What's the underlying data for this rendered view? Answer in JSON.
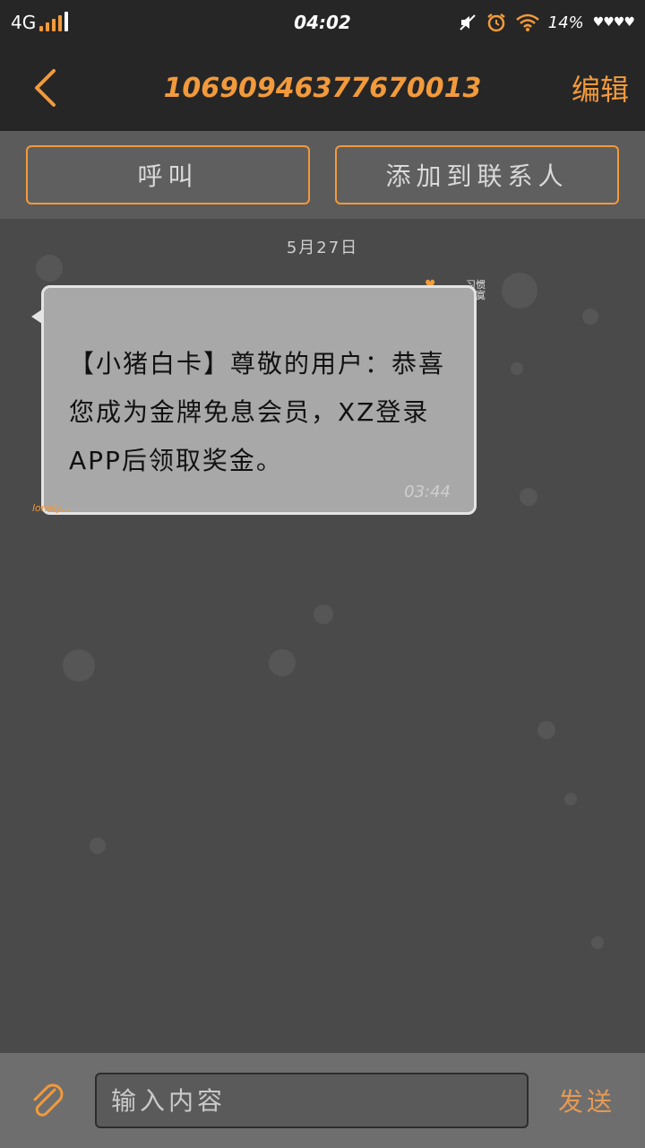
{
  "status_bar": {
    "network": "4G",
    "time": "04:02",
    "battery": "14%",
    "signal_level": 4
  },
  "header": {
    "title": "10690946377670013",
    "edit_label": "编辑",
    "back_icon": "chevron-left-icon"
  },
  "actions": {
    "call_label": "呼叫",
    "add_contact_label": "添加到联系人"
  },
  "conversation": {
    "date": "5月27日",
    "messages": [
      {
        "text": "【小猪白卡】尊敬的用户：恭喜您成为金牌免息会员，XZ登录APP后领取奖金。",
        "time": "03:44"
      }
    ],
    "decoration_text": "习惯寂寞",
    "decoration_tag": "lonely..."
  },
  "composer": {
    "placeholder": "输入内容",
    "send_label": "发送",
    "attach_icon": "paperclip-icon"
  },
  "colors": {
    "accent": "#f29a3c",
    "header_bg": "#262626",
    "chat_bg": "#4a4a4a",
    "bubble_bg": "#a8a8a8"
  }
}
